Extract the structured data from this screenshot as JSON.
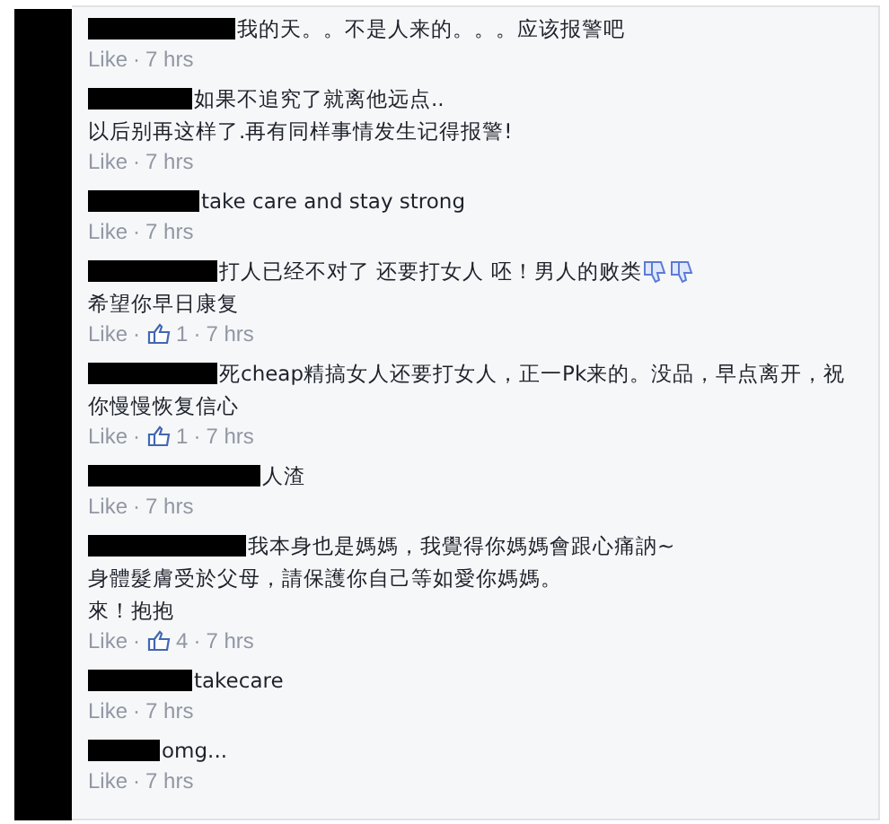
{
  "comments": [
    {
      "kind": "plain",
      "lines": [
        "我的天。。不是人来的。。。应该报警吧"
      ],
      "like": "Like",
      "separator": "·",
      "time": "7 hrs"
    },
    {
      "kind": "plain",
      "lines": [
        "如果不追究了就离他远点..",
        "以后别再这样了.再有同样事情发生记得报警!"
      ],
      "like": "Like",
      "separator": "·",
      "time": "7 hrs"
    },
    {
      "kind": "plain",
      "lines": [
        "take care and stay strong"
      ],
      "like": "Like",
      "separator": "·",
      "time": "7 hrs"
    },
    {
      "kind": "with_emoji",
      "lines": [
        "打人已经不对了 还要打女人 呸！男人的败类",
        "希望你早日康复"
      ],
      "like": "Like",
      "separator": "·",
      "likes": "1",
      "time": "7 hrs"
    },
    {
      "kind": "plain",
      "lines": [
        "死cheap精搞女人还要打女人，正一Pk来的。没品，早点离开，祝",
        "你慢慢恢复信心"
      ],
      "like": "Like",
      "separator": "·",
      "likes": "1",
      "time": "7 hrs"
    },
    {
      "kind": "plain",
      "lines": [
        "人渣"
      ],
      "like": "Like",
      "separator": "·",
      "time": "7 hrs"
    },
    {
      "kind": "plain",
      "lines": [
        "我本身也是媽媽，我覺得你媽媽會跟心痛訥~",
        "身體髮膚受於父母，請保護你自己等如愛你媽媽。",
        "來！抱抱"
      ],
      "like": "Like",
      "separator": "·",
      "likes": "4",
      "time": "7 hrs"
    },
    {
      "kind": "plain",
      "lines": [
        "takecare"
      ],
      "like": "Like",
      "separator": "·",
      "time": "7 hrs"
    },
    {
      "kind": "plain",
      "lines": [
        "omg..."
      ],
      "like": "Like",
      "separator": "·",
      "time": "7 hrs"
    }
  ]
}
